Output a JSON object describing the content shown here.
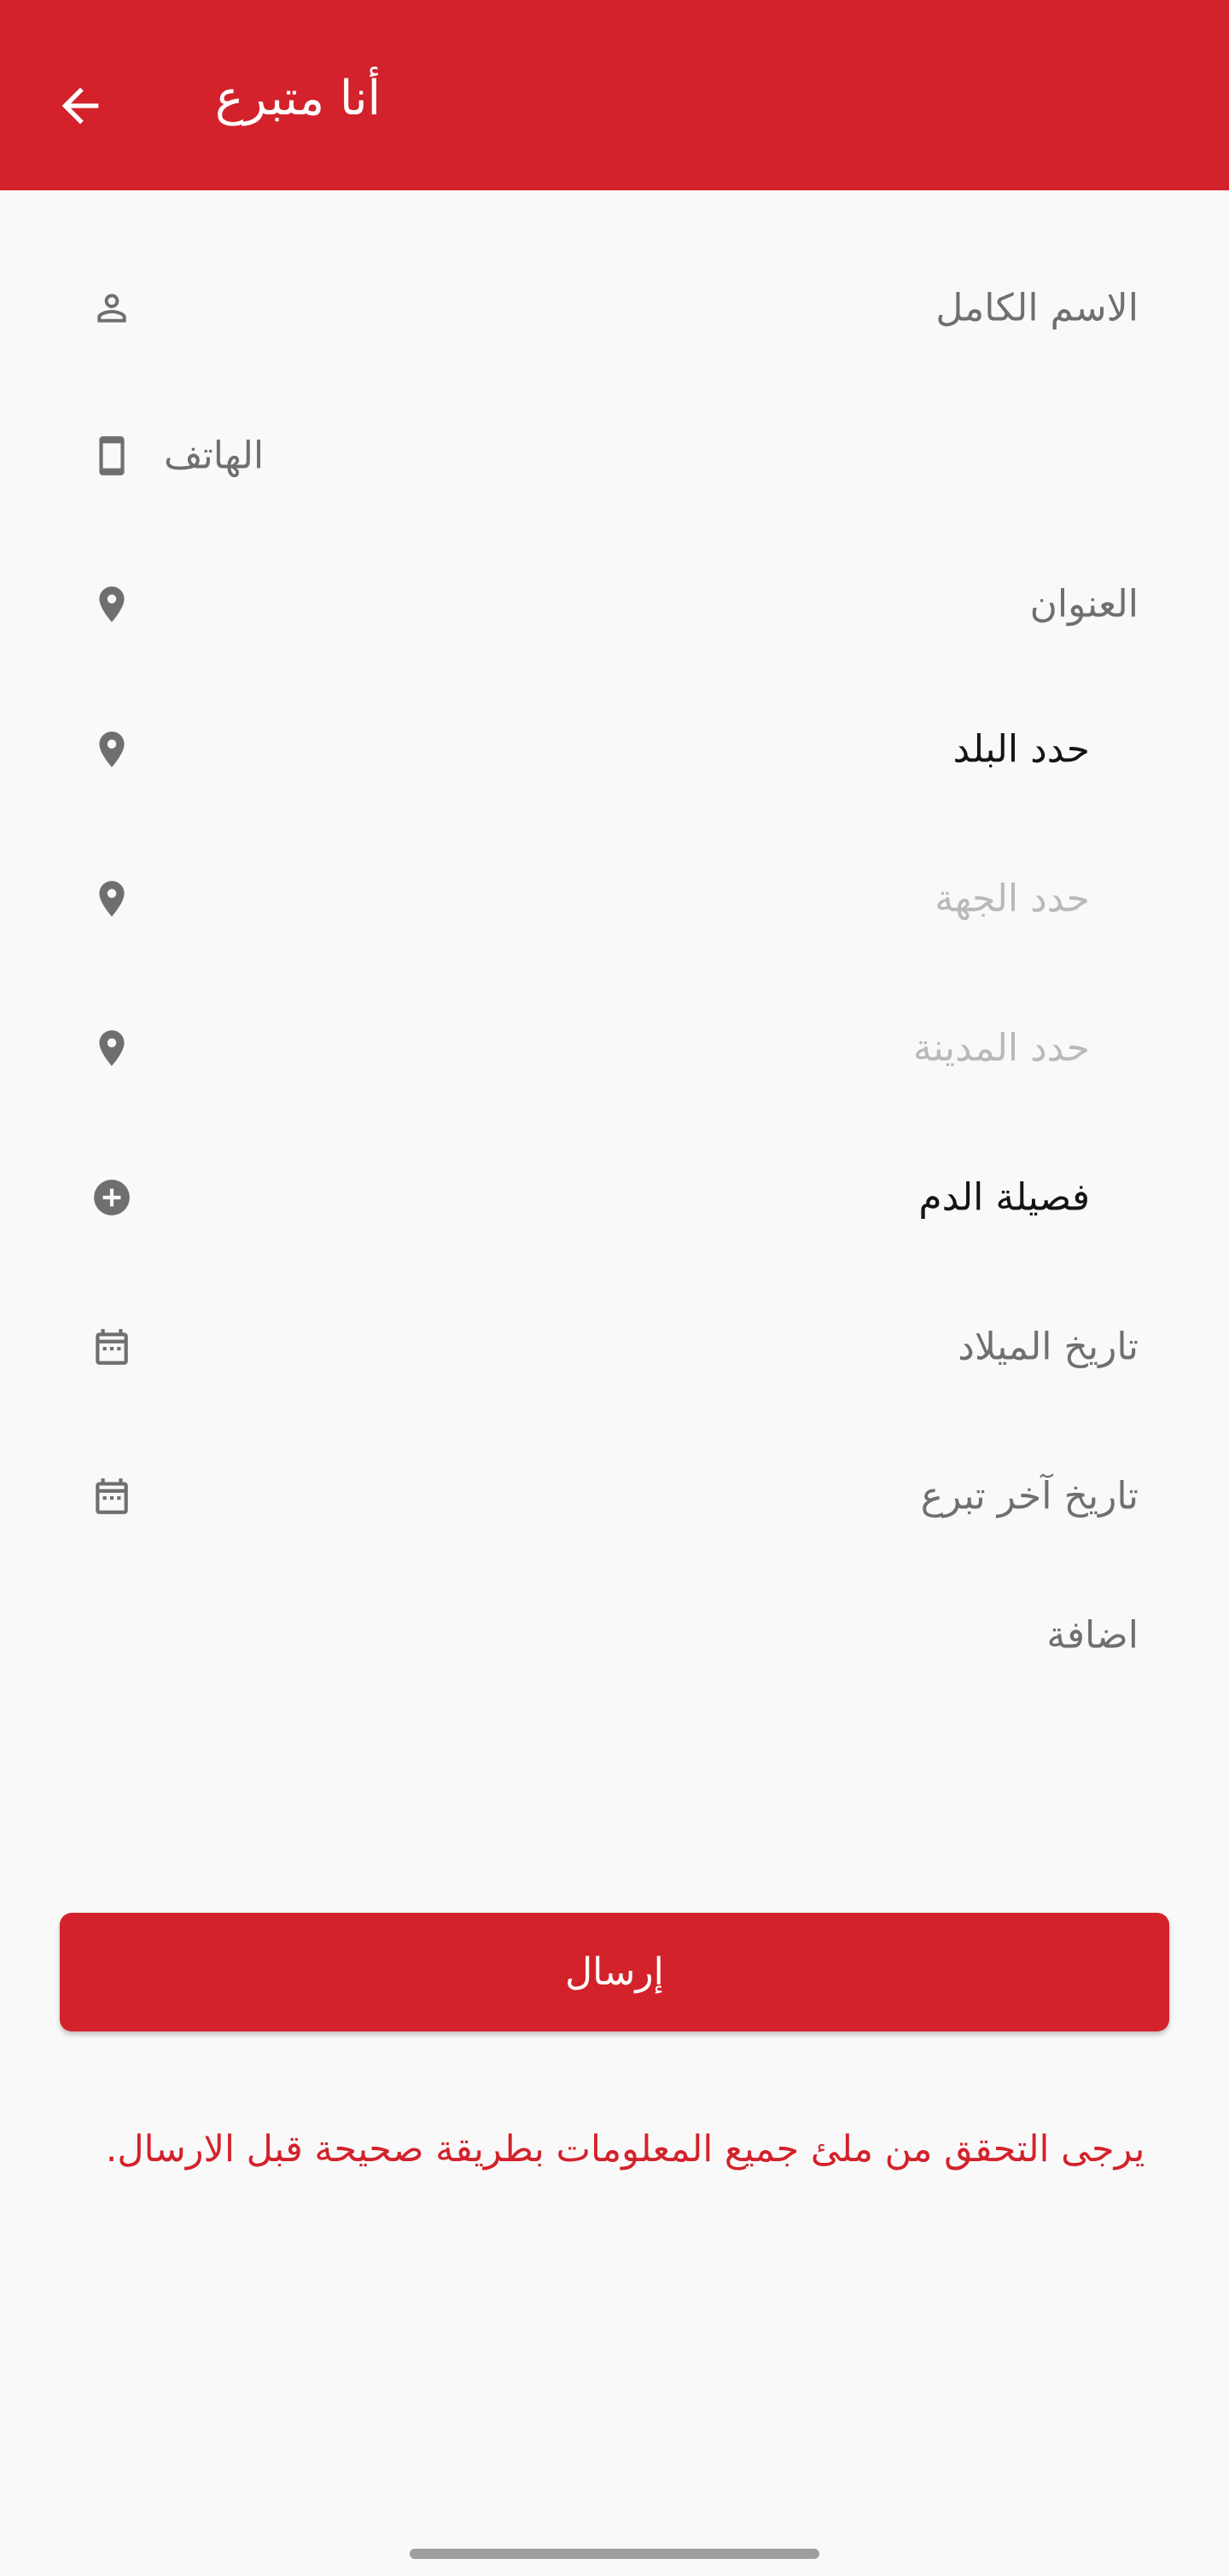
{
  "app_bar": {
    "title": "أنا متبرع",
    "back_icon": "arrow-back-icon",
    "color": "#d3222b"
  },
  "fields": {
    "full_name": {
      "label": "الاسم الكامل",
      "icon": "person-icon"
    },
    "phone": {
      "label": "الهاتف",
      "icon": "smartphone-icon"
    },
    "address": {
      "label": "العنوان",
      "icon": "location-pin-icon"
    },
    "country": {
      "label": "حدد البلد",
      "icon": "location-pin-icon"
    },
    "region": {
      "label": "حدد الجهة",
      "icon": "location-pin-icon"
    },
    "city": {
      "label": "حدد المدينة",
      "icon": "location-pin-icon"
    },
    "blood_type": {
      "label": "فصيلة الدم",
      "icon": "add-circle-icon"
    },
    "birth_date": {
      "label": "تاريخ الميلاد",
      "icon": "calendar-icon"
    },
    "last_donation_date": {
      "label": "تاريخ آخر تبرع",
      "icon": "calendar-icon"
    },
    "notes": {
      "label": "اضافة"
    }
  },
  "submit": {
    "label": "إرسال"
  },
  "warning": {
    "text": "يرجى التحقق من ملئ جميع المعلومات بطريقة صحيحة قبل الارسال.",
    "color": "#d3222b"
  }
}
